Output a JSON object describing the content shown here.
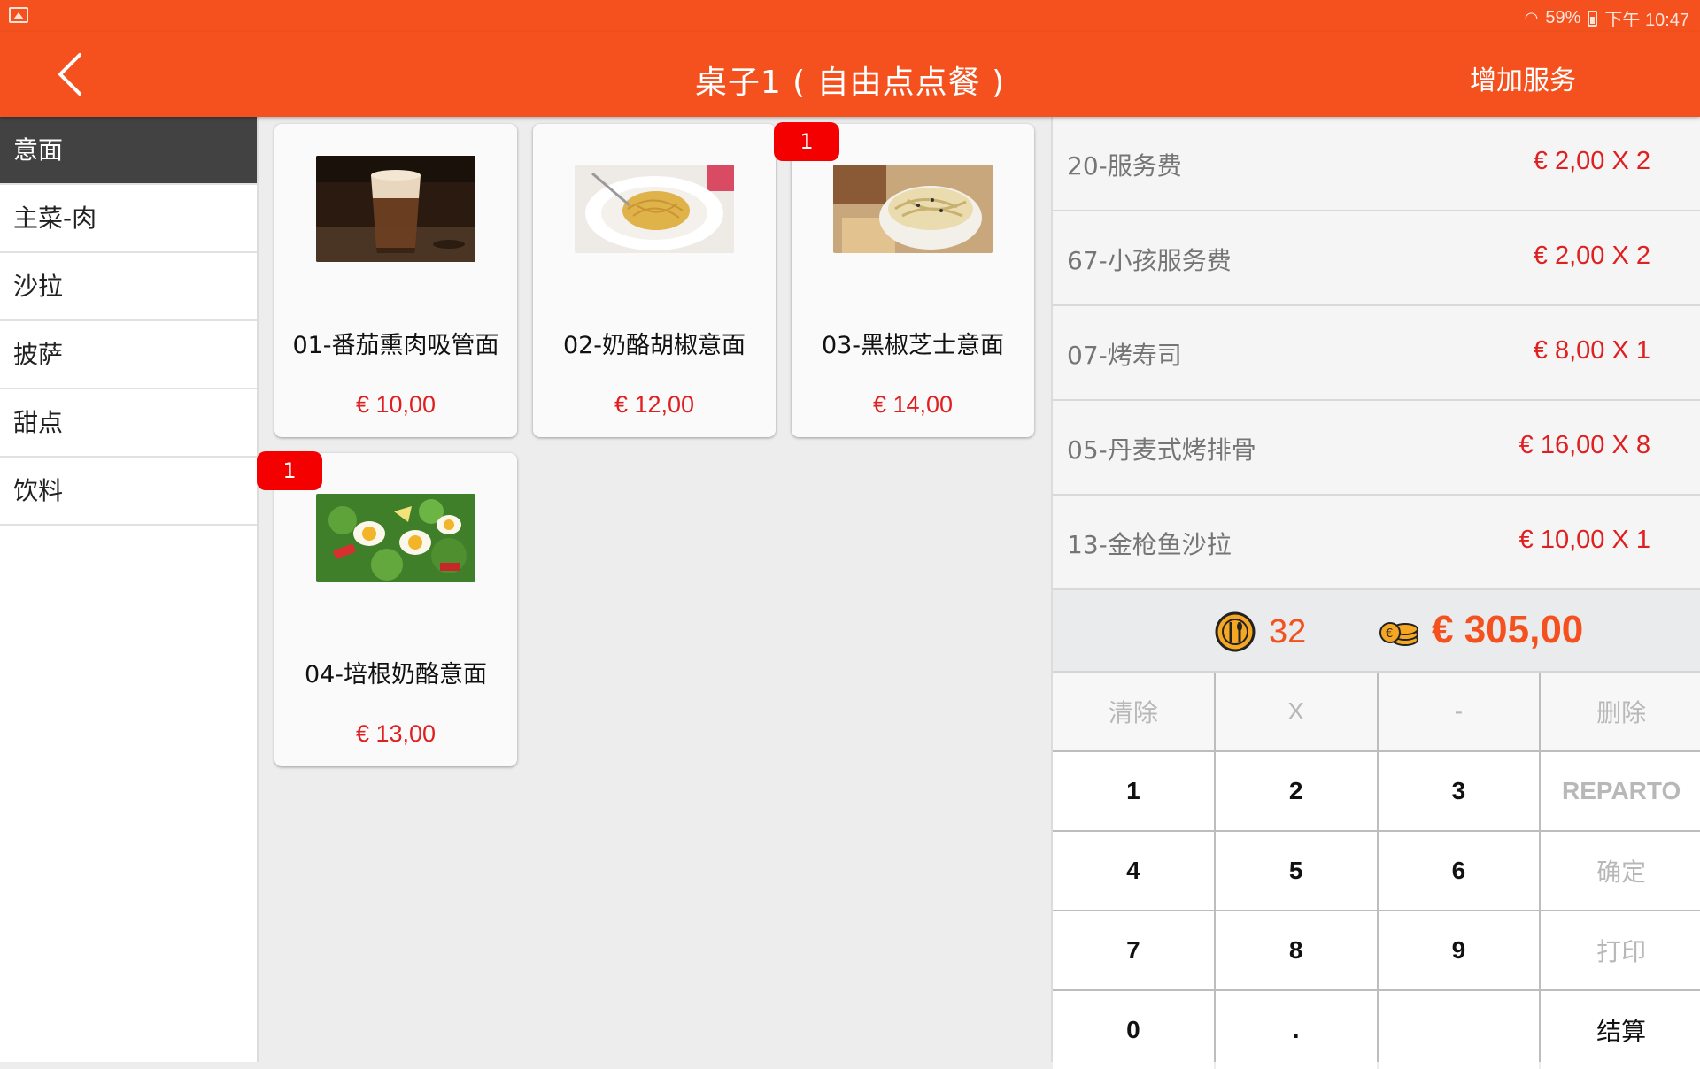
{
  "status_bar": {
    "battery": "59%",
    "time": "下午 10:47"
  },
  "app_bar": {
    "title": "桌子1 ( 自由点点餐 )",
    "action": "增加服务"
  },
  "categories": [
    {
      "label": "意面",
      "active": true
    },
    {
      "label": "主菜-肉"
    },
    {
      "label": "沙拉"
    },
    {
      "label": "披萨"
    },
    {
      "label": "甜点"
    },
    {
      "label": "饮料"
    }
  ],
  "products": [
    {
      "name": "01-番茄熏肉吸管面",
      "price": "€ 10,00",
      "badge": "",
      "image": "coffee-glass"
    },
    {
      "name": "02-奶酪胡椒意面",
      "price": "€ 12,00",
      "badge": "",
      "image": "spaghetti-plate"
    },
    {
      "name": "03-黑椒芝士意面",
      "price": "€ 14,00",
      "badge": "1",
      "image": "pasta-bowl"
    },
    {
      "name": "04-培根奶酪意面",
      "price": "€ 13,00",
      "badge": "1",
      "image": "egg-salad"
    }
  ],
  "order_items": [
    {
      "name": "20-服务费",
      "price": "€ 2,00  X 2"
    },
    {
      "name": "67-小孩服务费",
      "price": "€ 2,00  X 2"
    },
    {
      "name": "07-烤寿司",
      "price": "€ 8,00  X 1"
    },
    {
      "name": "05-丹麦式烤排骨",
      "price": "€ 16,00  X 8"
    },
    {
      "name": "13-金枪鱼沙拉",
      "price": "€ 10,00  X 1"
    }
  ],
  "summary": {
    "count": "32",
    "total": "€ 305,00",
    "count_icon": "cutlery-icon",
    "total_icon": "coins-icon"
  },
  "keypad": {
    "row1": [
      "清除",
      "X",
      "-",
      "删除"
    ],
    "row2": [
      "1",
      "2",
      "3",
      "REPARTO"
    ],
    "row3": [
      "4",
      "5",
      "6",
      "确定"
    ],
    "row4": [
      "7",
      "8",
      "9",
      "打印"
    ],
    "row5": [
      "0",
      ".",
      "",
      "结算"
    ]
  },
  "colors": {
    "brand": "#f4511e",
    "price": "#e02020",
    "badge": "#f40000",
    "active_category": "#424242"
  }
}
